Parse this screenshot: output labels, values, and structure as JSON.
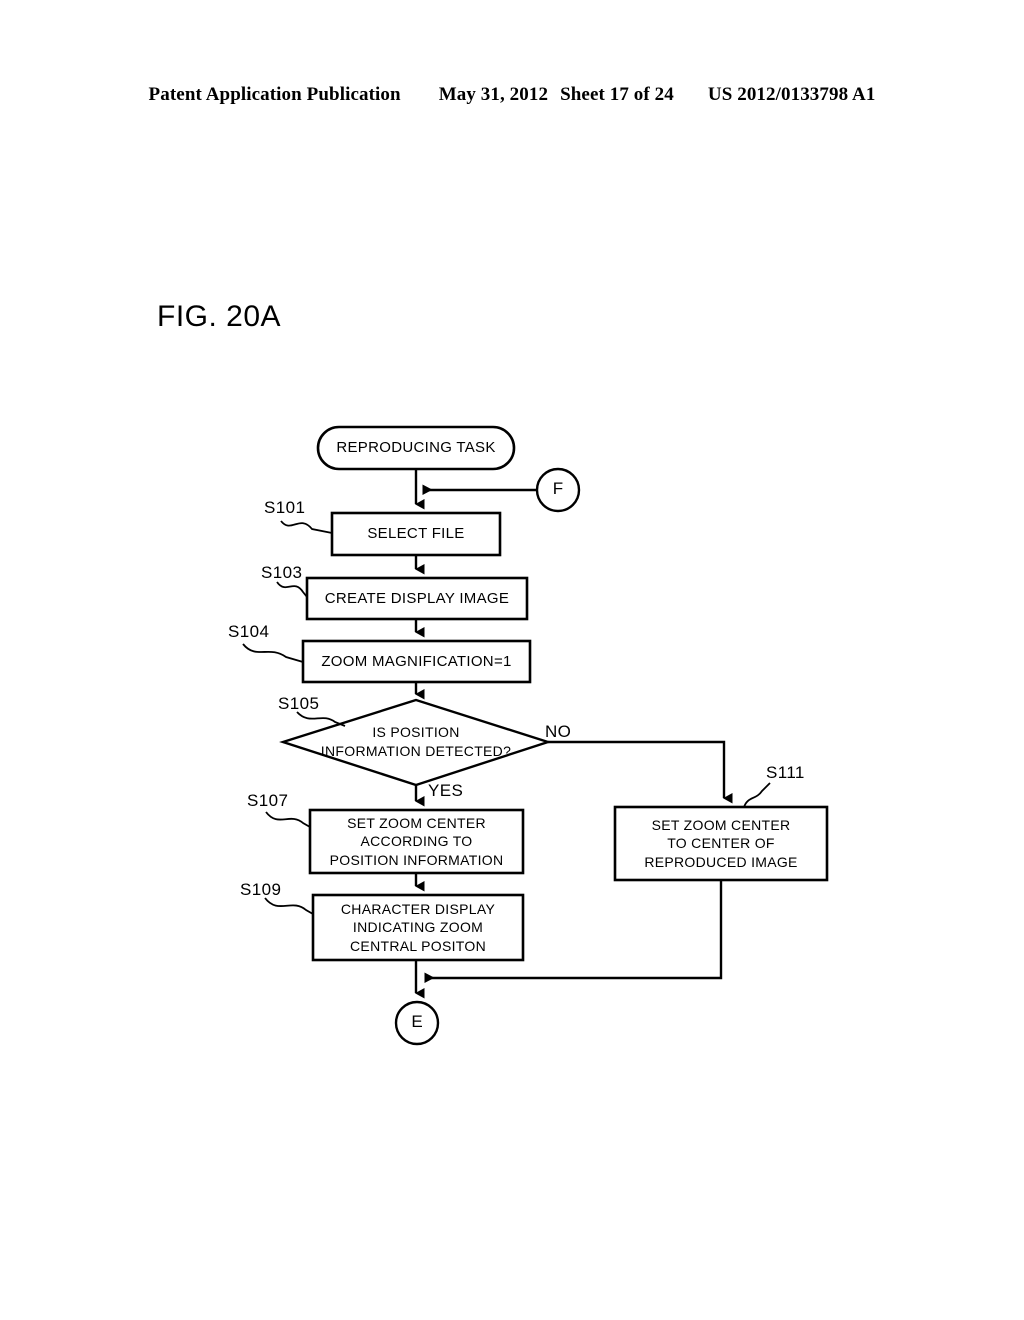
{
  "header": {
    "publication": "Patent Application Publication",
    "date": "May 31, 2012",
    "sheet": "Sheet 17 of 24",
    "number": "US 2012/0133798 A1"
  },
  "figure": {
    "title": "FIG. 20A"
  },
  "flowchart": {
    "start": {
      "label": "REPRODUCING TASK"
    },
    "connectors": {
      "entry": "F",
      "exit": "E"
    },
    "branches": {
      "yes": "YES",
      "no": "NO"
    },
    "steps": [
      {
        "id": "S101",
        "ref": "S101",
        "shape": "process",
        "lines": [
          "SELECT FILE"
        ]
      },
      {
        "id": "S103",
        "ref": "S103",
        "shape": "process",
        "lines": [
          "CREATE DISPLAY IMAGE"
        ]
      },
      {
        "id": "S104",
        "ref": "S104",
        "shape": "process",
        "lines": [
          "ZOOM MAGNIFICATION=1"
        ]
      },
      {
        "id": "S105",
        "ref": "S105",
        "shape": "decision",
        "lines": [
          "IS POSITION",
          "INFORMATION DETECTED?"
        ]
      },
      {
        "id": "S107",
        "ref": "S107",
        "shape": "process",
        "lines": [
          "SET ZOOM CENTER",
          "ACCORDING TO",
          "POSITION INFORMATION"
        ]
      },
      {
        "id": "S109",
        "ref": "S109",
        "shape": "process",
        "lines": [
          "CHARACTER DISPLAY",
          "INDICATING ZOOM",
          "CENTRAL POSITON"
        ]
      },
      {
        "id": "S111",
        "ref": "S111",
        "shape": "process",
        "lines": [
          "SET ZOOM CENTER",
          "TO CENTER OF",
          "REPRODUCED IMAGE"
        ]
      }
    ]
  },
  "colors": {
    "ink": "#000000",
    "paper": "#ffffff"
  }
}
